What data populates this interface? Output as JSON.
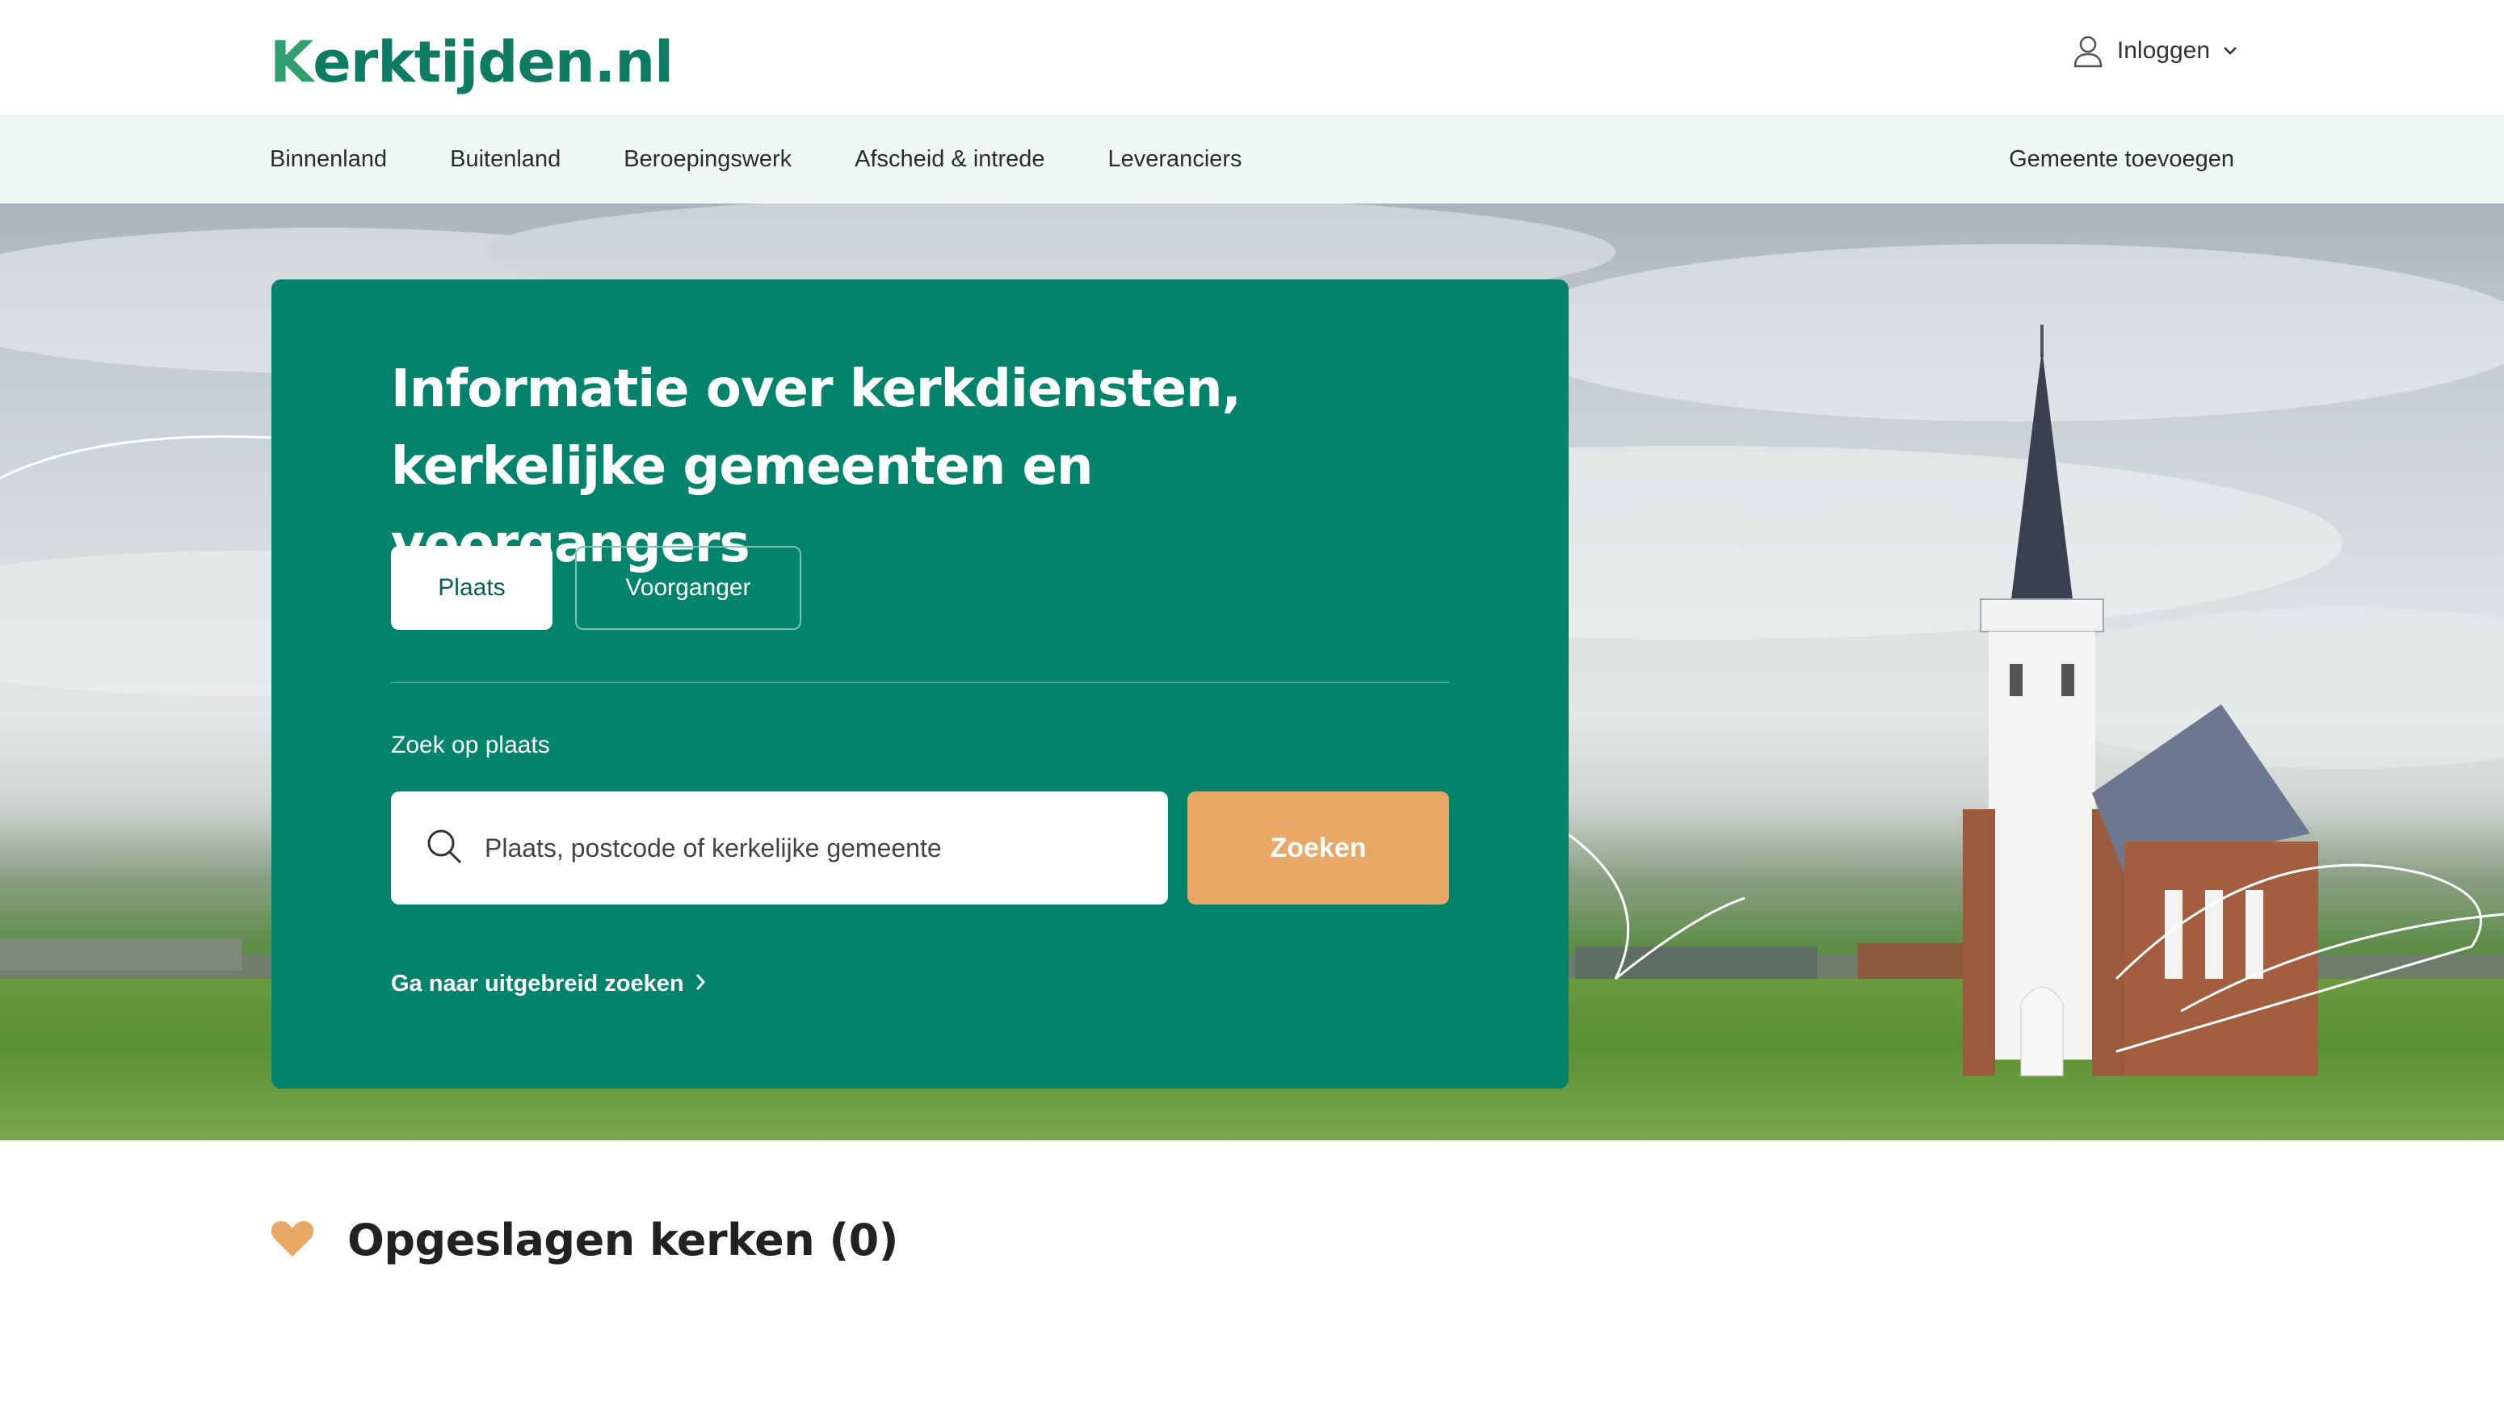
{
  "header": {
    "logo_text": "erktijden.nl",
    "logo_k": "K",
    "login_label": "Inloggen"
  },
  "nav": {
    "items": [
      {
        "label": "Binnenland"
      },
      {
        "label": "Buitenland"
      },
      {
        "label": "Beroepingswerk"
      },
      {
        "label": "Afscheid & intrede"
      },
      {
        "label": "Leveranciers"
      }
    ],
    "right_label": "Gemeente toevoegen"
  },
  "hero": {
    "title_line1": "Informatie over kerkdiensten,",
    "title_line2": "kerkelijke gemeenten en voorgangers",
    "tabs": [
      {
        "label": "Plaats",
        "selected": true
      },
      {
        "label": "Voorganger",
        "selected": false
      }
    ],
    "search_label": "Zoek op plaats",
    "search_placeholder": "Plaats, postcode of kerkelijke gemeente",
    "search_button": "Zoeken",
    "advanced_link": "Ga naar uitgebreid zoeken"
  },
  "saved": {
    "title": "Opgeslagen kerken (0)"
  },
  "colors": {
    "brand_green": "#02846c",
    "accent_orange": "#e9a865",
    "nav_bg": "#eef7f2"
  },
  "icons": {
    "user": "user-icon",
    "chevron": "chevron-down-icon",
    "search": "search-icon",
    "heart": "heart-icon",
    "chevron_right": "chevron-right-icon"
  }
}
